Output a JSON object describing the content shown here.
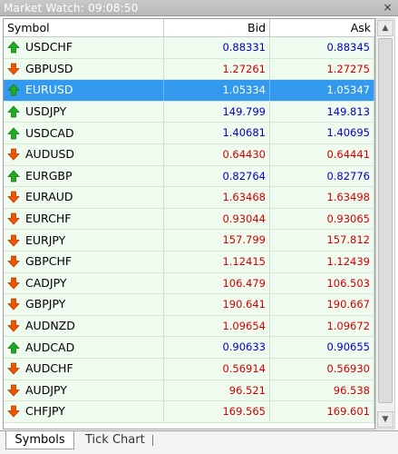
{
  "window": {
    "title": "Market Watch: 09:08:50",
    "close_label": "×"
  },
  "table": {
    "headers": {
      "symbol": "Symbol",
      "bid": "Bid",
      "ask": "Ask"
    },
    "rows": [
      {
        "symbol": "USDCHF",
        "bid": "0.88331",
        "ask": "0.88345",
        "direction": "up"
      },
      {
        "symbol": "GBPUSD",
        "bid": "1.27261",
        "ask": "1.27275",
        "direction": "down"
      },
      {
        "symbol": "EURUSD",
        "bid": "1.05334",
        "ask": "1.05347",
        "direction": "up",
        "selected": true
      },
      {
        "symbol": "USDJPY",
        "bid": "149.799",
        "ask": "149.813",
        "direction": "up"
      },
      {
        "symbol": "USDCAD",
        "bid": "1.40681",
        "ask": "1.40695",
        "direction": "up"
      },
      {
        "symbol": "AUDUSD",
        "bid": "0.64430",
        "ask": "0.64441",
        "direction": "down"
      },
      {
        "symbol": "EURGBP",
        "bid": "0.82764",
        "ask": "0.82776",
        "direction": "up"
      },
      {
        "symbol": "EURAUD",
        "bid": "1.63468",
        "ask": "1.63498",
        "direction": "down"
      },
      {
        "symbol": "EURCHF",
        "bid": "0.93044",
        "ask": "0.93065",
        "direction": "down"
      },
      {
        "symbol": "EURJPY",
        "bid": "157.799",
        "ask": "157.812",
        "direction": "down"
      },
      {
        "symbol": "GBPCHF",
        "bid": "1.12415",
        "ask": "1.12439",
        "direction": "down"
      },
      {
        "symbol": "CADJPY",
        "bid": "106.479",
        "ask": "106.503",
        "direction": "down"
      },
      {
        "symbol": "GBPJPY",
        "bid": "190.641",
        "ask": "190.667",
        "direction": "down"
      },
      {
        "symbol": "AUDNZD",
        "bid": "1.09654",
        "ask": "1.09672",
        "direction": "down"
      },
      {
        "symbol": "AUDCAD",
        "bid": "0.90633",
        "ask": "0.90655",
        "direction": "up"
      },
      {
        "symbol": "AUDCHF",
        "bid": "0.56914",
        "ask": "0.56930",
        "direction": "down"
      },
      {
        "symbol": "AUDJPY",
        "bid": "96.521",
        "ask": "96.538",
        "direction": "down"
      },
      {
        "symbol": "CHFJPY",
        "bid": "169.565",
        "ask": "169.601",
        "direction": "down"
      }
    ]
  },
  "colors": {
    "up_price": "#0000c8",
    "down_price": "#d40000",
    "up_arrow": "#22aa22",
    "down_arrow": "#ee5500",
    "selected_row": "#3399ee",
    "row_background": "#f0fbf0"
  },
  "icons": {
    "up": "arrow-up-icon",
    "down": "arrow-down-icon",
    "close": "close-icon",
    "scroll_up": "scroll-up-icon",
    "scroll_down": "scroll-down-icon"
  },
  "tabs": [
    {
      "label": "Symbols",
      "active": true
    },
    {
      "label": "Tick Chart",
      "active": false
    }
  ]
}
